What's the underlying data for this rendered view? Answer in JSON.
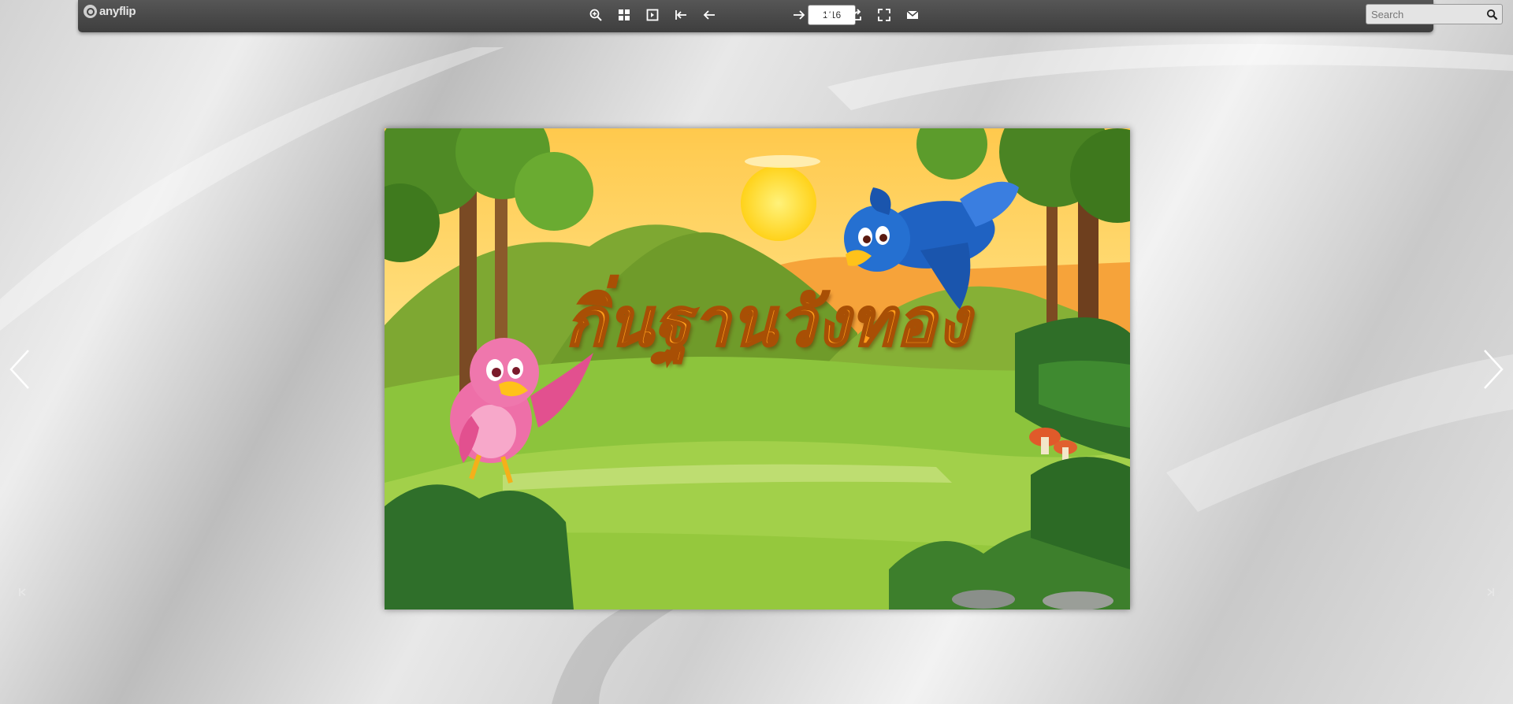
{
  "app": {
    "brand": "anyflip"
  },
  "toolbar": {
    "buttons": [
      "zoom-in",
      "thumbnails",
      "single-page",
      "first-page",
      "previous-page",
      "page-indicator",
      "next-page",
      "last-page",
      "share",
      "fullscreen",
      "email"
    ],
    "page_indicator": "1/16",
    "search_placeholder": "Search"
  },
  "book": {
    "title": "กิ่นฐานวังทอง",
    "current_page": 1,
    "total_pages": 16,
    "cover_colors": {
      "sky": "#ffd76a",
      "sun": "#ffe23a",
      "grass": "#8cc43c",
      "title": "#ff9d1a"
    }
  },
  "navigation": {
    "prev_arrow": "chevron-left",
    "next_arrow": "chevron-right"
  }
}
